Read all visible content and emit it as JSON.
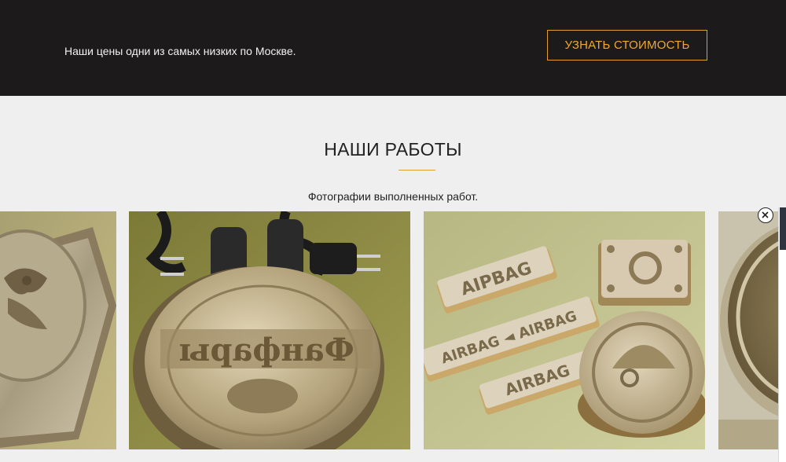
{
  "promo": {
    "text": "Наши цены одни из самых низких по Москве.",
    "button_label": "УЗНАТЬ СТОИМОСТЬ"
  },
  "works": {
    "title": "НАШИ РАБОТЫ",
    "subtitle": "Фотографии выполненных работ.",
    "gallery": [
      {
        "icon": "brass-stamp-eagle-photo"
      },
      {
        "icon": "brass-stamp-heaters-photo"
      },
      {
        "icon": "brass-stamp-letters-photo"
      },
      {
        "icon": "brass-stamp-round-photo"
      }
    ]
  },
  "overlay": {
    "close_icon": "close-icon"
  },
  "colors": {
    "band": "#1c1a1a",
    "accent": "#e0a030",
    "page": "#efefef",
    "text": "#222222"
  }
}
